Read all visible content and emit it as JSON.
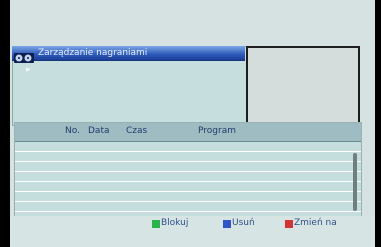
{
  "window": {
    "title": "Zarządzanie nagraniami"
  },
  "table": {
    "columns": [
      "No.",
      "Data",
      "Czas",
      "Program"
    ],
    "rows": []
  },
  "footer": {
    "buttons": [
      {
        "label": "Blokuj",
        "color": "#2bb24a"
      },
      {
        "label": "Usuń",
        "color": "#2d56c7"
      },
      {
        "label": "Zmień na",
        "color": "#d23434"
      }
    ]
  }
}
